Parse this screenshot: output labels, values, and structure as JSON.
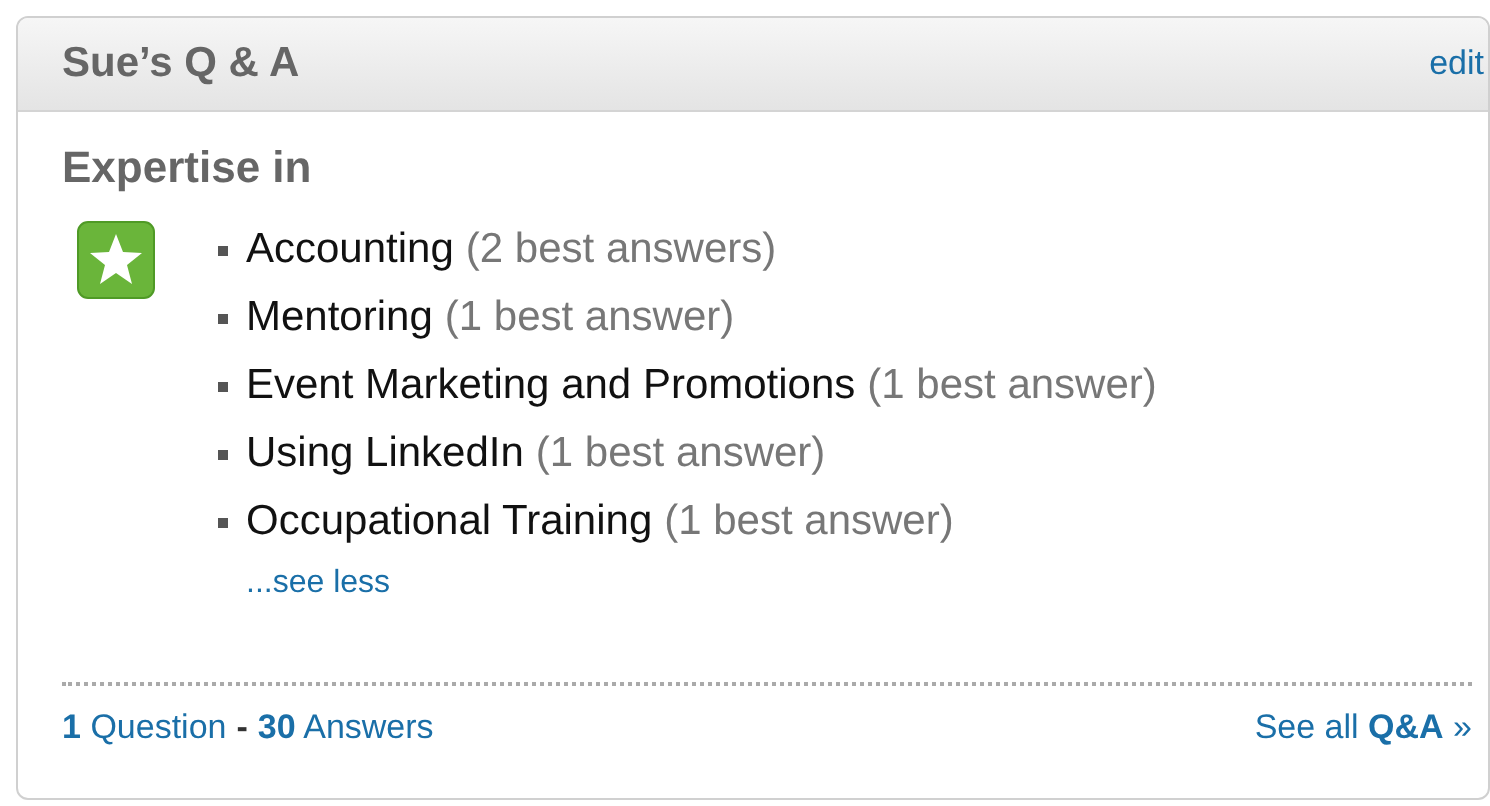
{
  "header": {
    "title": "Sue’s Q & A",
    "edit_link": "edit"
  },
  "section_title": "Expertise in",
  "expertise": [
    {
      "topic": "Accounting",
      "count": "(2 best answers)"
    },
    {
      "topic": "Mentoring",
      "count": "(1 best answer)"
    },
    {
      "topic": "Event Marketing and Promotions",
      "count": "(1 best answer)"
    },
    {
      "topic": "Using LinkedIn",
      "count": "(1 best answer)"
    },
    {
      "topic": "Occupational Training",
      "count": "(1 best answer)"
    }
  ],
  "see_less": "...see less",
  "footer": {
    "questions_link": "**1** Question",
    "separator": "-",
    "answers_link": "**30** Answers",
    "see_all_link": "See all **Q&A** »"
  }
}
